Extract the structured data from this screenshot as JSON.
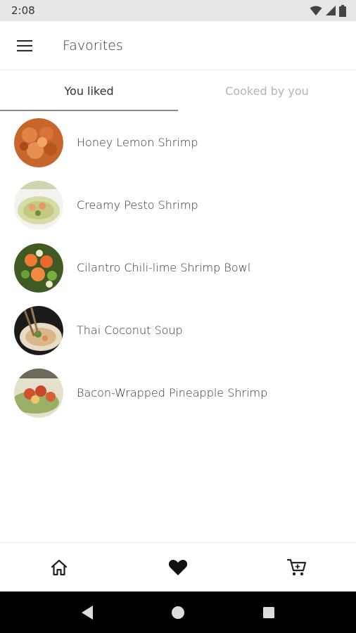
{
  "status_bar": {
    "time": "2:08",
    "icons": [
      "wifi-icon",
      "signal-icon",
      "battery-icon"
    ]
  },
  "app_bar": {
    "title": "Favorites",
    "menu_icon": "menu-icon"
  },
  "tabs": [
    {
      "label": "You liked",
      "active": true
    },
    {
      "label": "Cooked by you",
      "active": false
    }
  ],
  "recipes": [
    {
      "name": "Honey Lemon Shrimp"
    },
    {
      "name": "Creamy Pesto Shrimp"
    },
    {
      "name": "Cilantro Chili-lime Shrimp Bowl"
    },
    {
      "name": "Thai Coconut Soup"
    },
    {
      "name": "Bacon-Wrapped Pineapple Shrimp"
    }
  ],
  "bottom_nav": {
    "items": [
      {
        "icon": "home-icon",
        "active": false
      },
      {
        "icon": "heart-icon",
        "active": true
      },
      {
        "icon": "cart-icon",
        "active": false
      }
    ]
  },
  "system_nav": [
    "back-icon",
    "home-circle-icon",
    "recents-icon"
  ],
  "colors": {
    "status_bar_bg": "#e6e6e6",
    "text_primary": "#333333",
    "text_inactive": "#b3b3b3",
    "system_nav_bg": "#000000"
  }
}
